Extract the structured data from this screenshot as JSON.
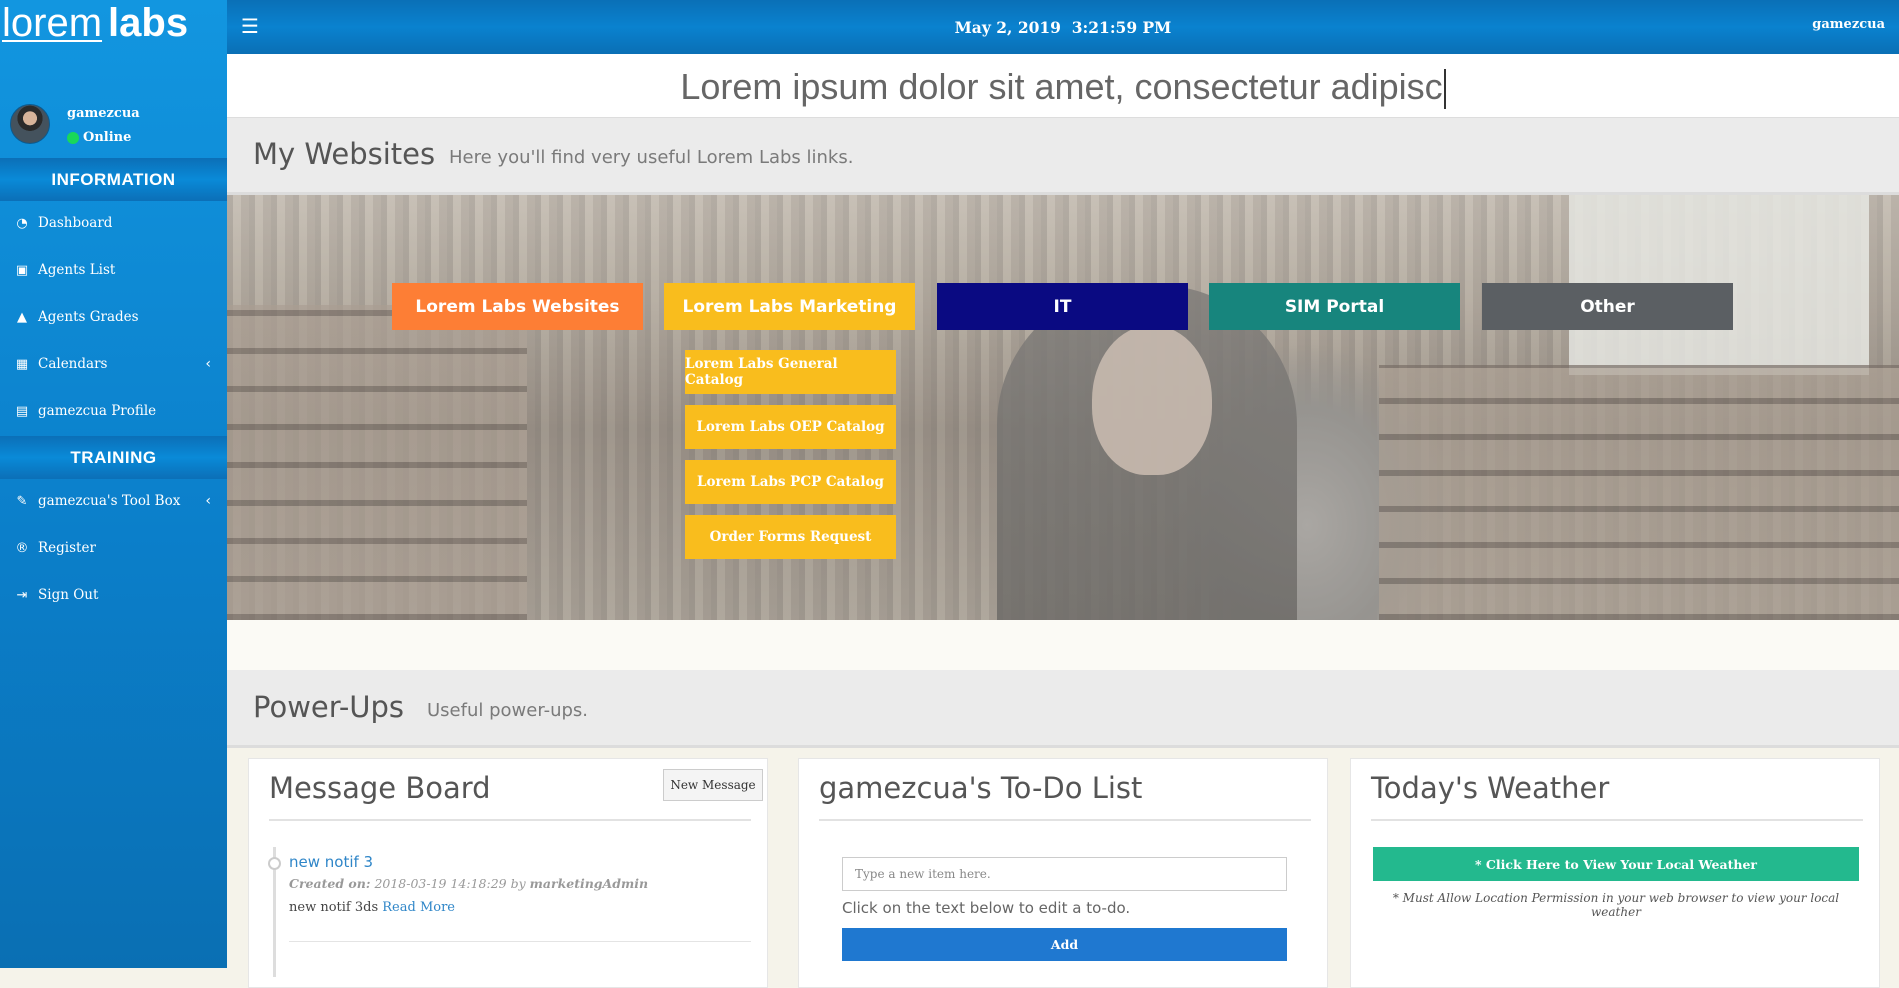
{
  "brand": {
    "logo_light": "lorem",
    "logo_bold": "labs"
  },
  "sidebar": {
    "user": {
      "name": "gamezcua",
      "status": "Online"
    },
    "sections": {
      "information": "INFORMATION",
      "training": "TRAINING"
    },
    "items": [
      {
        "label": "Dashboard",
        "icon": "dashboard-icon"
      },
      {
        "label": "Agents List",
        "icon": "id-badge-icon"
      },
      {
        "label": "Agents Grades",
        "icon": "graduation-cap-icon"
      },
      {
        "label": "Calendars",
        "icon": "calendar-icon"
      },
      {
        "label": "gamezcua Profile",
        "icon": "id-card-icon"
      },
      {
        "label": "gamezcua's Tool Box",
        "icon": "wrench-icon"
      },
      {
        "label": "Register",
        "icon": "registered-icon"
      },
      {
        "label": "Sign Out",
        "icon": "sign-out-icon"
      }
    ]
  },
  "topbar": {
    "datetime": "May 2, 2019  3:21:59 PM",
    "user": "gamezcua"
  },
  "marquee": {
    "text": "Lorem ipsum dolor sit amet, consectetur adipisc"
  },
  "websites": {
    "title": "My Websites",
    "subtitle": "Here you'll find very useful Lorem Labs links.",
    "categories": [
      {
        "label": "Lorem Labs Websites",
        "color": "#fd7e35"
      },
      {
        "label": "Lorem Labs Marketing",
        "color": "#f9bd1d"
      },
      {
        "label": "IT",
        "color": "#0a0a82"
      },
      {
        "label": "SIM Portal",
        "color": "#17857d"
      },
      {
        "label": "Other",
        "color": "#5b5f63"
      }
    ],
    "marketing_links": [
      "Lorem Labs General Catalog",
      "Lorem Labs OEP Catalog",
      "Lorem Labs PCP Catalog",
      "Order Forms Request"
    ]
  },
  "powerups": {
    "title": "Power-Ups",
    "subtitle": "Useful power-ups.",
    "message_board": {
      "title": "Message Board",
      "new_button": "New Message",
      "notif": {
        "title": "new notif 3",
        "created_label": "Created on:",
        "created_value": "2018-03-19 14:18:29",
        "by_label": "by",
        "author": "marketingAdmin",
        "body": "new notif 3ds",
        "read_more": "Read More"
      }
    },
    "todo": {
      "title": "gamezcua's To-Do List",
      "placeholder": "Type a new item here.",
      "hint": "Click on the text below to edit a to-do.",
      "add_button": "Add"
    },
    "weather": {
      "title": "Today's Weather",
      "button": "* Click Here to View Your Local Weather",
      "note": "* Must Allow Location Permission in your web browser to view your local weather"
    }
  }
}
